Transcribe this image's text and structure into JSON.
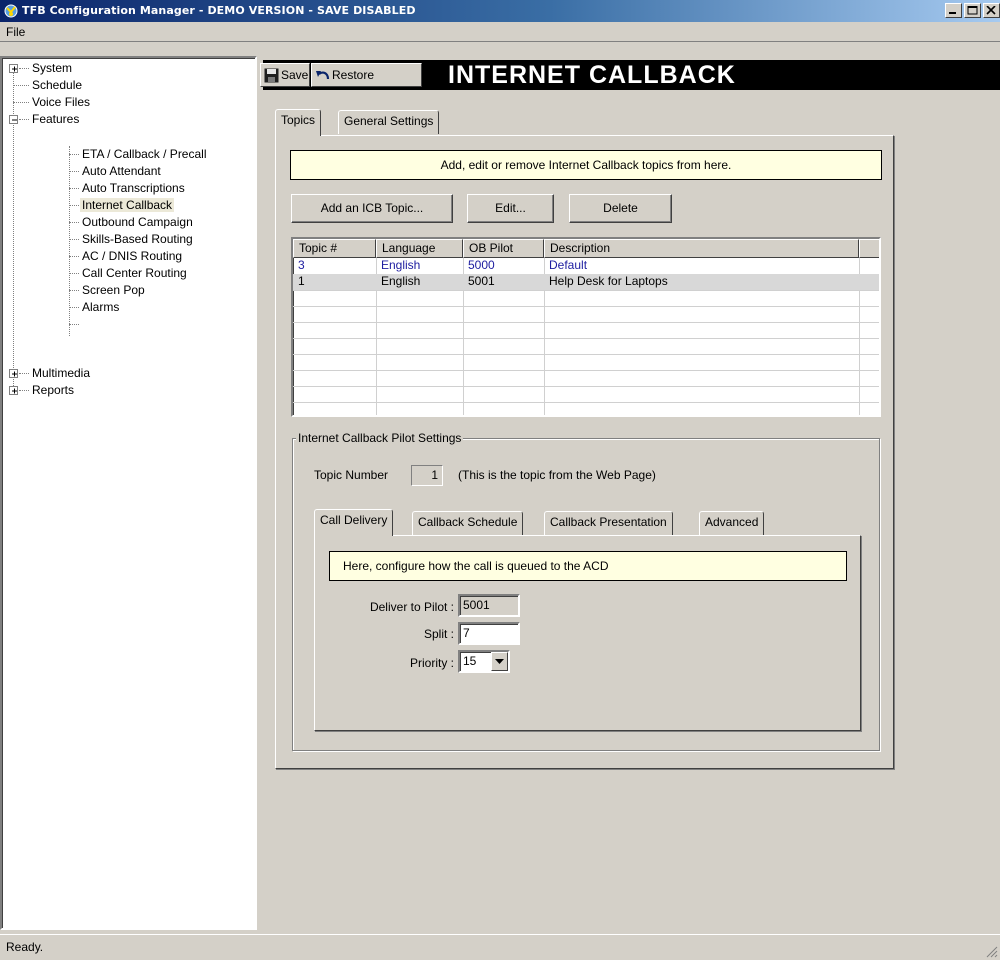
{
  "window": {
    "title": "TFB Configuration Manager - DEMO VERSION - SAVE DISABLED",
    "app_icon": "tfb-app-icon",
    "caption_buttons": [
      "minimize",
      "maximize",
      "close"
    ]
  },
  "menu": {
    "file": "File"
  },
  "tree": {
    "items": [
      {
        "label": "System",
        "expander": "+"
      },
      {
        "label": "Schedule"
      },
      {
        "label": "Voice Files"
      },
      {
        "label": "Features",
        "expander": "-"
      },
      {
        "label": "ETA / Callback / Precall"
      },
      {
        "label": "Auto Attendant"
      },
      {
        "label": "Auto Transcriptions"
      },
      {
        "label": "Internet Callback",
        "selected": true
      },
      {
        "label": "Outbound Campaign"
      },
      {
        "label": "Skills-Based Routing"
      },
      {
        "label": "AC / DNIS Routing"
      },
      {
        "label": "Call Center Routing"
      },
      {
        "label": "Screen Pop"
      },
      {
        "label": "Alarms"
      },
      {
        "label": "Multimedia",
        "expander": "+"
      },
      {
        "label": "Reports",
        "expander": "+"
      }
    ]
  },
  "toolbar": {
    "save_label": "Save",
    "restore_label": "Restore",
    "page_title": "INTERNET CALLBACK"
  },
  "main_tabs": [
    {
      "label": "Topics",
      "active": true
    },
    {
      "label": "General Settings",
      "active": false
    }
  ],
  "topics": {
    "info": "Add, edit or remove Internet Callback topics from here.",
    "buttons": {
      "add": "Add an ICB Topic...",
      "edit": "Edit...",
      "delete": "Delete"
    },
    "columns": [
      "Topic #",
      "Language",
      "OB Pilot",
      "Description"
    ],
    "rows": [
      {
        "topic": "3",
        "language": "English",
        "ob_pilot": "5000",
        "description": "Default"
      },
      {
        "topic": "1",
        "language": "English",
        "ob_pilot": "5001",
        "description": "Help Desk for Laptops"
      }
    ]
  },
  "pilot_settings": {
    "group_label": "Internet Callback Pilot Settings",
    "topic_number_label": "Topic Number",
    "topic_number_value": "1",
    "topic_note": "(This is the topic from the Web Page)",
    "tabs": [
      {
        "label": "Call Delivery",
        "active": true
      },
      {
        "label": "Callback Schedule",
        "active": false
      },
      {
        "label": "Callback Presentation",
        "active": false
      },
      {
        "label": "Advanced",
        "active": false
      }
    ],
    "call_delivery": {
      "info": "Here, configure how the call is queued to the ACD",
      "deliver_label": "Deliver to Pilot :",
      "deliver_value": "5001",
      "split_label": "Split :",
      "split_value": "7",
      "priority_label": "Priority :",
      "priority_value": "15"
    }
  },
  "status": {
    "text": "Ready."
  }
}
